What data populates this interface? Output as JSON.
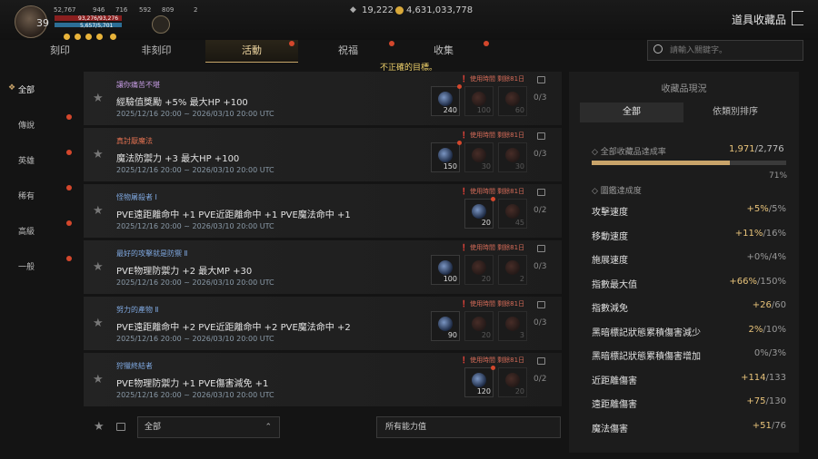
{
  "player": {
    "level": "39",
    "stats": [
      "52,767",
      "946",
      "716",
      "592",
      "809",
      "2"
    ],
    "hp_text": "93,276/93,276",
    "mp_text": "5,657/5,701"
  },
  "currency": {
    "gem": "19,222",
    "gold": "4,631,033,778"
  },
  "page_title": "道具收藏品",
  "tabs": [
    "刻印",
    "非刻印",
    "活動",
    "祝福",
    "收集"
  ],
  "search_placeholder": "請輸入關鍵字。",
  "warning": "不正確的目標。",
  "sidebar": [
    "全部",
    "傳說",
    "英雄",
    "稀有",
    "高級",
    "一般"
  ],
  "cards": [
    {
      "title": "讓你痛苦不堪",
      "effect": "經驗值獎勵 +5% 最大HP +100",
      "date": "2025/12/16 20:00 ~ 2026/03/10 20:00 UTC",
      "timer": "使用時間 剩餘81日",
      "slots": [
        "240",
        "100",
        "60"
      ],
      "ratio": "0/3"
    },
    {
      "title": "真討厭魔法",
      "effect": "魔法防禦力 +3 最大HP +100",
      "date": "2025/12/16 20:00 ~ 2026/03/10 20:00 UTC",
      "timer": "使用時間 剩餘81日",
      "slots": [
        "150",
        "30",
        "30"
      ],
      "ratio": "0/3"
    },
    {
      "title": "怪物屠殺者 Ⅰ",
      "effect": "PVE遠距離命中 +1 PVE近距離命中 +1 PVE魔法命中 +1",
      "date": "2025/12/16 20:00 ~ 2026/03/10 20:00 UTC",
      "timer": "使用時間 剩餘81日",
      "slots": [
        "20",
        "45"
      ],
      "ratio": "0/2"
    },
    {
      "title": "最好的攻擊就是防禦 Ⅱ",
      "effect": "PVE物理防禦力 +2 最大MP +30",
      "date": "2025/12/16 20:00 ~ 2026/03/10 20:00 UTC",
      "timer": "使用時間 剩餘81日",
      "slots": [
        "100",
        "20",
        "2"
      ],
      "ratio": "0/3"
    },
    {
      "title": "努力的產物 Ⅱ",
      "effect": "PVE遠距離命中 +2 PVE近距離命中 +2 PVE魔法命中 +2",
      "date": "2025/12/16 20:00 ~ 2026/03/10 20:00 UTC",
      "timer": "使用時間 剩餘81日",
      "slots": [
        "90",
        "20",
        "3"
      ],
      "ratio": "0/3"
    },
    {
      "title": "狩獵終結者",
      "effect": "PVE物理防禦力 +1 PVE傷害減免 +1",
      "date": "2025/12/16 20:00 ~ 2026/03/10 20:00 UTC",
      "timer": "使用時間 剩餘81日",
      "slots": [
        "120",
        "20"
      ],
      "ratio": "0/2"
    }
  ],
  "filter": {
    "grade": "全部",
    "ability": "所有能力值"
  },
  "status": {
    "title": "收藏品現況",
    "tab_all": "全部",
    "tab_category": "依類別排序",
    "rate_label": "全部收藏品達成率",
    "rate_current": "1,971",
    "rate_total": "/2,776",
    "rate_fraction": 0.71,
    "rate_pct": "71%",
    "section2": "圖鑑達成度",
    "rows": [
      {
        "label": "攻擊速度",
        "cur": "+5%",
        "max": "5%"
      },
      {
        "label": "移動速度",
        "cur": "+11%",
        "max": "16%"
      },
      {
        "label": "施展速度",
        "cur": "+0%",
        "max": "4%"
      },
      {
        "label": "指數最大值",
        "cur": "+66%",
        "max": "150%"
      },
      {
        "label": "指數減免",
        "cur": "+26",
        "max": "60"
      },
      {
        "label": "黑暗標記狀態累積傷害減少",
        "cur": "2%",
        "max": "10%"
      },
      {
        "label": "黑暗標記狀態累積傷害增加",
        "cur": "0%",
        "max": "3%"
      },
      {
        "label": "近距離傷害",
        "cur": "+114",
        "max": "133"
      },
      {
        "label": "遠距離傷害",
        "cur": "+75",
        "max": "130"
      },
      {
        "label": "魔法傷害",
        "cur": "+51",
        "max": "76"
      }
    ]
  },
  "colors": {
    "accent": "#e8c37a",
    "alert": "#d4472c",
    "warning": "#f1d36b"
  }
}
